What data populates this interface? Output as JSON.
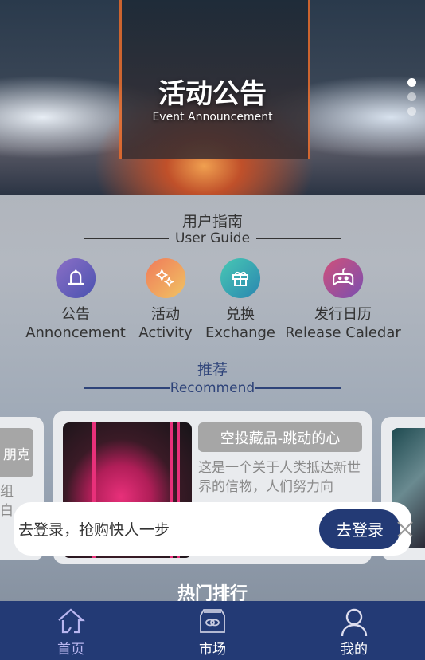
{
  "banner": {
    "title": "活动公告",
    "subtitle": "Event Announcement",
    "slide_count": 3,
    "active_slide": 1
  },
  "guide": {
    "title": "用户指南",
    "subtitle": "User Guide",
    "items": [
      {
        "cn": "公告",
        "en": "Annoncement",
        "icon": "bell-icon",
        "colors": [
          "#6b6fc9",
          "#9a5cb8"
        ]
      },
      {
        "cn": "活动",
        "en": "Activity",
        "icon": "sparkle-icon",
        "colors": [
          "#f07d5a",
          "#f0c060"
        ]
      },
      {
        "cn": "兑换",
        "en": "Exchange",
        "icon": "gift-icon",
        "colors": [
          "#3fc6b8",
          "#2a8fb0"
        ]
      },
      {
        "cn": "发行日历",
        "en": "Release Caledar",
        "icon": "gamepad-icon",
        "colors": [
          "#c8507e",
          "#7a4fb0"
        ]
      }
    ]
  },
  "recommend": {
    "title": "推荐",
    "subtitle": "Recommend",
    "cards": [
      {
        "title": "朋克",
        "desc": "组\n白"
      },
      {
        "title": "空投藏品-跳动的心",
        "desc": "这是一个关于人类抵达新世界的信物，人们努力向"
      },
      {
        "title": "",
        "desc": ""
      }
    ]
  },
  "popup": {
    "text": "去登录，抢购快人一步",
    "button": "去登录"
  },
  "hot": {
    "title": "热门排行"
  },
  "nav": {
    "items": [
      {
        "label": "首页",
        "icon": "home-icon"
      },
      {
        "label": "市场",
        "icon": "market-icon"
      },
      {
        "label": "我的",
        "icon": "user-icon"
      }
    ]
  },
  "colors": {
    "primary": "#233a75",
    "nav_active": "#b9b6f0"
  }
}
